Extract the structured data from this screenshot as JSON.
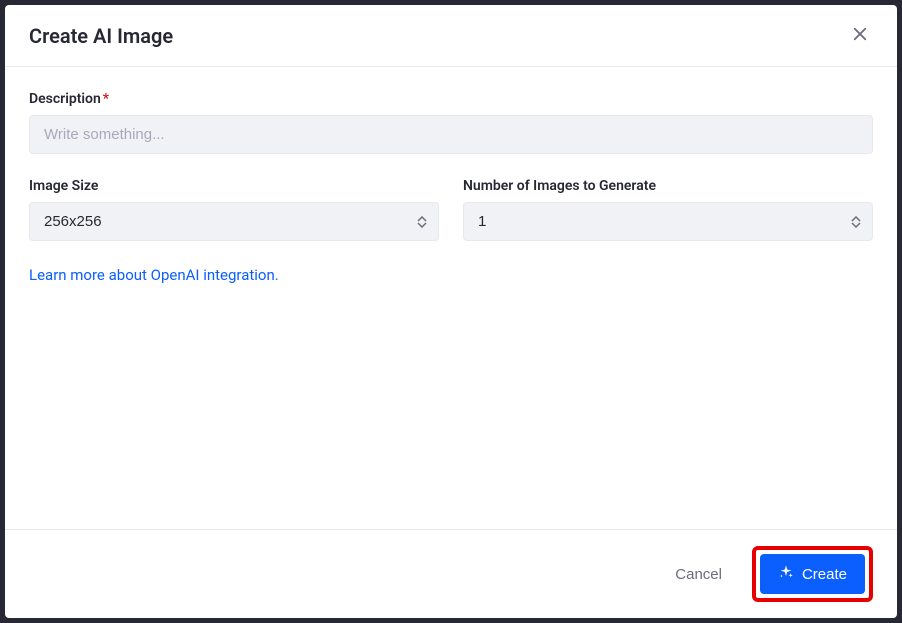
{
  "modal": {
    "title": "Create AI Image"
  },
  "form": {
    "description": {
      "label": "Description",
      "required_mark": "*",
      "placeholder": "Write something...",
      "value": ""
    },
    "image_size": {
      "label": "Image Size",
      "value": "256x256"
    },
    "num_images": {
      "label": "Number of Images to Generate",
      "value": "1"
    },
    "learn_more_link": "Learn more about OpenAI integration."
  },
  "footer": {
    "cancel_label": "Cancel",
    "create_label": "Create"
  }
}
